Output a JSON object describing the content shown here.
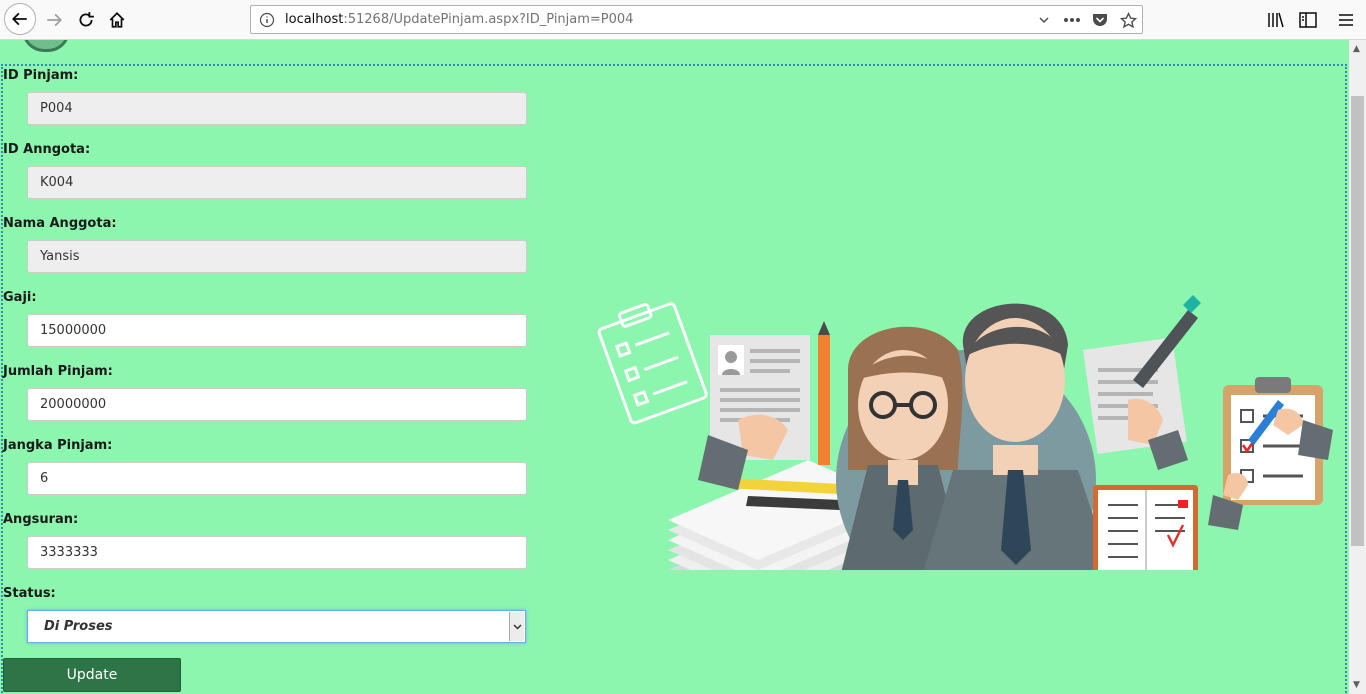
{
  "browser": {
    "url_host": "localhost",
    "url_rest": ":51268/UpdatePinjam.aspx?ID_Pinjam=P004"
  },
  "form": {
    "fields": [
      {
        "label": "ID Pinjam:",
        "value": "P004"
      },
      {
        "label": "ID Anngota:",
        "value": "K004"
      },
      {
        "label": "Nama Anggota:",
        "value": "Yansis"
      },
      {
        "label": "Gaji:",
        "value": "15000000"
      },
      {
        "label": "Jumlah Pinjam:",
        "value": "20000000"
      },
      {
        "label": "Jangka Pinjam:",
        "value": "6"
      },
      {
        "label": "Angsuran:",
        "value": "3333333"
      }
    ],
    "status_label": "Status:",
    "status_value": "Di Proses",
    "submit_label": "Update"
  },
  "colors": {
    "page_bg": "#8cf5ae",
    "button_bg": "#2d7546"
  }
}
